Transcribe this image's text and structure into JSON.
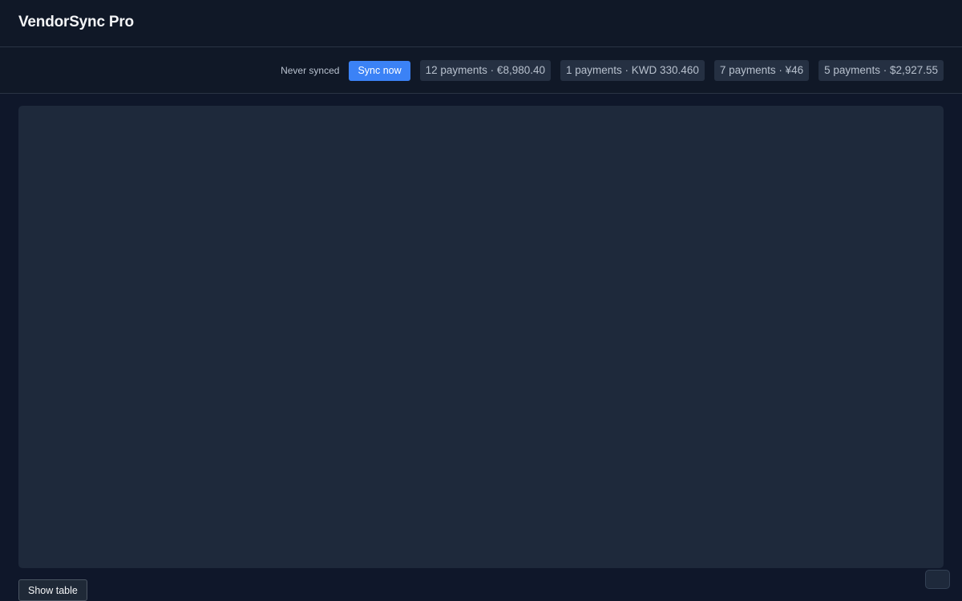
{
  "app": {
    "title": "VendorSync Pro"
  },
  "toolbar": {
    "sync_status": "Never synced",
    "sync_button_label": "Sync now",
    "summaries": [
      "12 payments · €8,980.40",
      "1 payments · KWD 330.460",
      "7 payments · ¥46",
      "5 payments · $2,927.55"
    ]
  },
  "footer": {
    "show_table_label": "Show table"
  },
  "colors": {
    "accent": "#3b82f6",
    "background": "#0f172a",
    "panel": "#1e293b"
  }
}
